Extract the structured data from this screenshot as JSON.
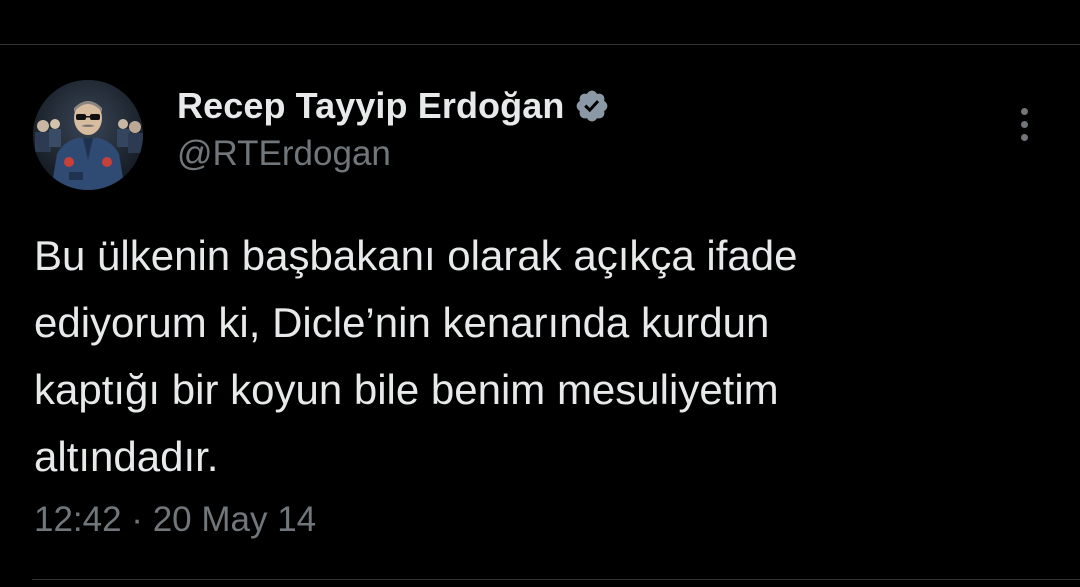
{
  "tweet": {
    "author": {
      "display_name": "Recep Tayyip Erdoğan",
      "handle": "@RTErdogan",
      "verified": true,
      "verified_icon": "verified-badge-icon",
      "verified_color": "#8b98a5",
      "avatar_icon": "profile-photo"
    },
    "text_lines": [
      "Bu ülkenin başbakanı olarak açıkça ifade",
      "ediyorum ki, Dicle’nin kenarında kurdun",
      "kaptığı bir koyun bile benim mesuliyetim",
      "altındadır."
    ],
    "timestamp": "12:42 · 20 May 14",
    "more_icon": "more-vertical-icon"
  },
  "colors": {
    "background": "#000000",
    "primary_text": "#e7e9ea",
    "secondary_text": "#71767b",
    "divider": "#2f3336"
  }
}
